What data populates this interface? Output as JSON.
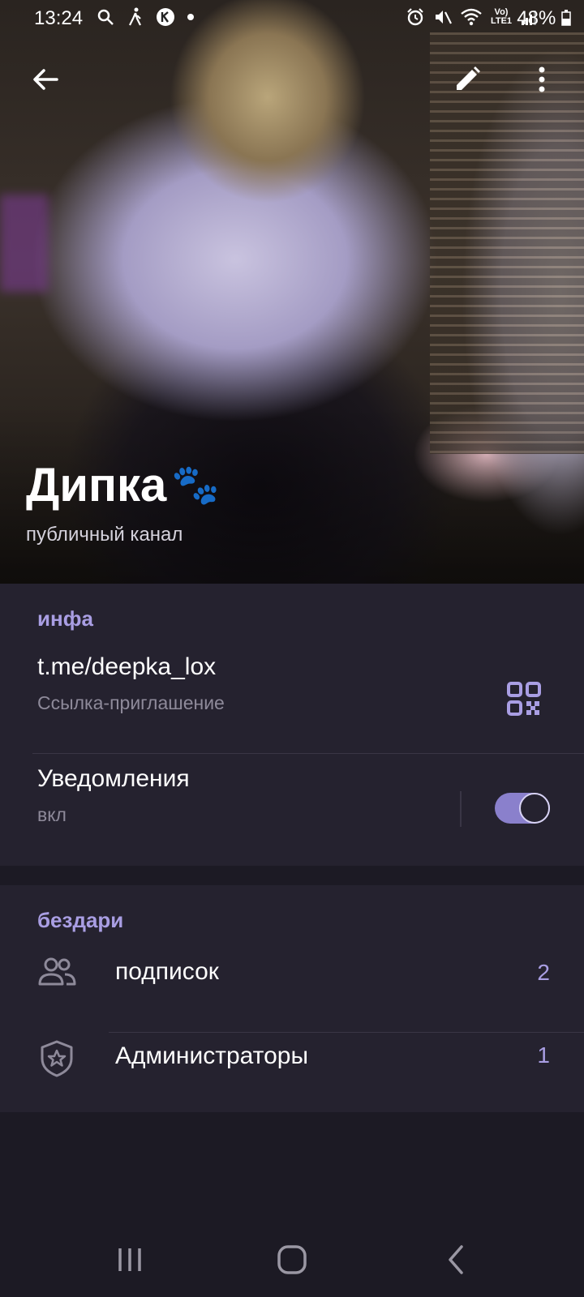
{
  "status_bar": {
    "time": "13:24",
    "battery": "48%",
    "network": "Vo) LTE1"
  },
  "channel": {
    "name": "Дипка",
    "name_emoji": "🐾",
    "type": "публичный канал"
  },
  "info_section": {
    "header": "инфа",
    "link": {
      "value": "t.me/deepka_lox",
      "label": "Ссылка-приглашение"
    },
    "notifications": {
      "title": "Уведомления",
      "state": "вкл",
      "enabled": true
    }
  },
  "members_section": {
    "header": "бездари",
    "items": [
      {
        "label": "подписок",
        "count": "2",
        "icon": "people-icon"
      },
      {
        "label": "Администраторы",
        "count": "1",
        "icon": "shield-star-icon"
      }
    ]
  },
  "colors": {
    "accent": "#a99ee3",
    "background": "#1c1a24",
    "card": "#25222f",
    "toggle": "#8a80cc"
  }
}
